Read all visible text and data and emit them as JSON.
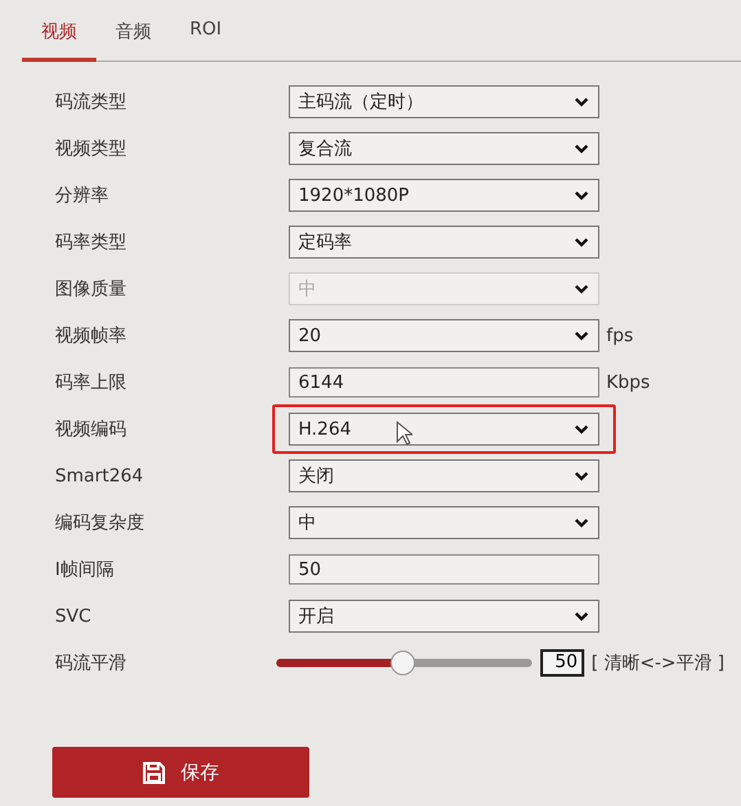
{
  "tabs": [
    {
      "label": "视频",
      "selected": true
    },
    {
      "label": "音频",
      "selected": false
    },
    {
      "label": "ROI",
      "selected": false
    }
  ],
  "fields": [
    {
      "kind": "select",
      "label": "码流类型",
      "value": "主码流（定时）"
    },
    {
      "kind": "select",
      "label": "视频类型",
      "value": "复合流"
    },
    {
      "kind": "select",
      "label": "分辨率",
      "value": "1920*1080P"
    },
    {
      "kind": "select",
      "label": "码率类型",
      "value": "定码率"
    },
    {
      "kind": "select",
      "label": "图像质量",
      "value": "中",
      "disabled": true
    },
    {
      "kind": "select",
      "label": "视频帧率",
      "value": "20",
      "unit": "fps"
    },
    {
      "kind": "input",
      "label": "码率上限",
      "value": "6144",
      "unit": "Kbps"
    },
    {
      "kind": "select",
      "label": "视频编码",
      "value": "H.264",
      "highlighted": true
    },
    {
      "kind": "select",
      "label": "Smart264",
      "value": "关闭"
    },
    {
      "kind": "select",
      "label": "编码复杂度",
      "value": "中"
    },
    {
      "kind": "input",
      "label": "I帧间隔",
      "value": "50"
    },
    {
      "kind": "select",
      "label": "SVC",
      "value": "开启"
    },
    {
      "kind": "slider",
      "label": "码流平滑",
      "level": 0.49,
      "value": "50",
      "unit": "[ 清晰<->平滑 ]"
    }
  ],
  "save_button": {
    "label": "保存"
  }
}
